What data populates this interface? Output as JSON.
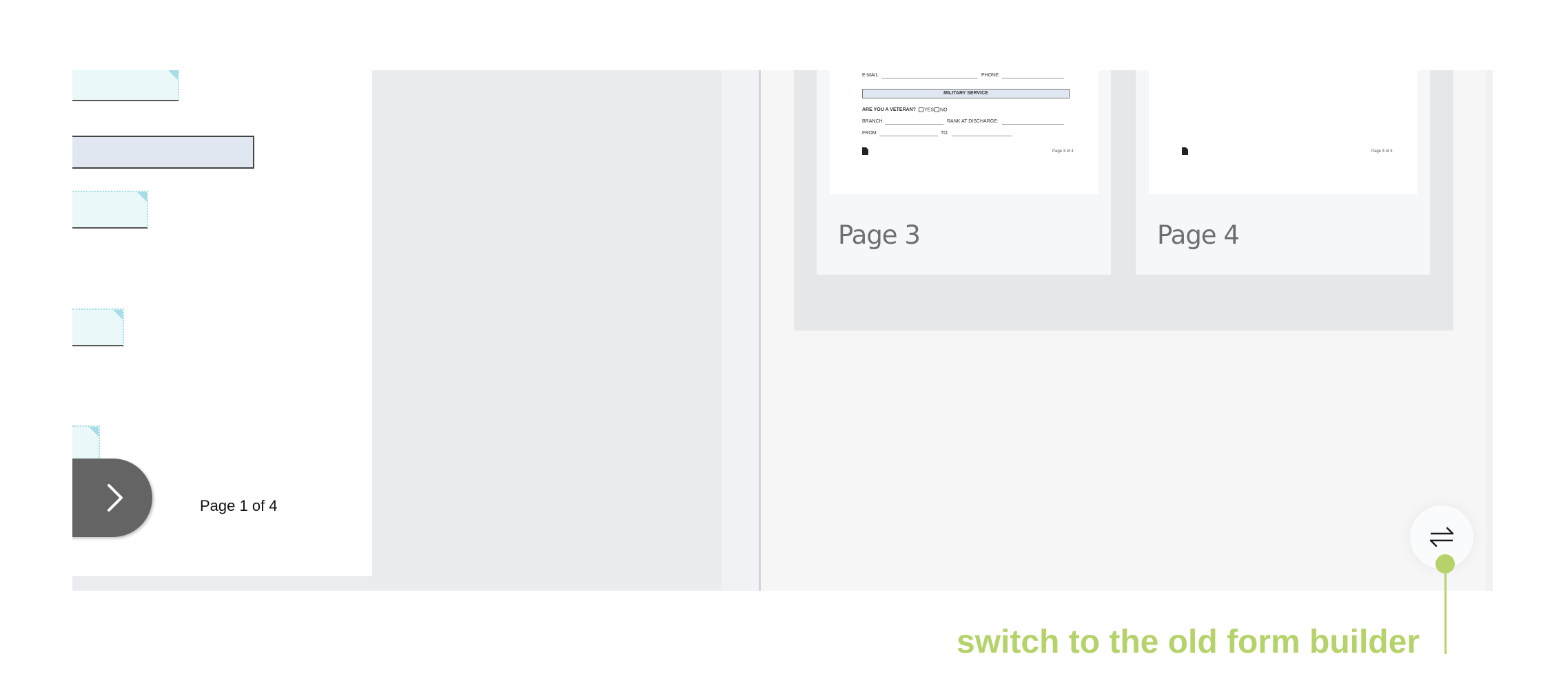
{
  "document_viewer": {
    "page_counter": "Page 1 of 4",
    "next_page_icon": "chevron-right-icon"
  },
  "thumbnails": [
    {
      "label": "Page 3",
      "content": {
        "email_label": "E-MAIL:",
        "phone_label": "PHONE:",
        "section_title": "MILITARY SERVICE",
        "veteran_question": "ARE YOU A VETERAN?",
        "yes_label": "YES",
        "no_label": "NO",
        "branch_label": "BRANCH:",
        "rank_label": "RANK AT DISCHARGE:",
        "from_label": "FROM:",
        "to_label": "TO:",
        "footer": "Page 3 of 4"
      }
    },
    {
      "label": "Page 4",
      "content": {
        "footer": "Page 4 of 4"
      }
    }
  ],
  "switch_button": {
    "icon": "swap-arrows-icon"
  },
  "annotation": {
    "text": "switch to the old form builder",
    "color": "#b5d36a"
  }
}
